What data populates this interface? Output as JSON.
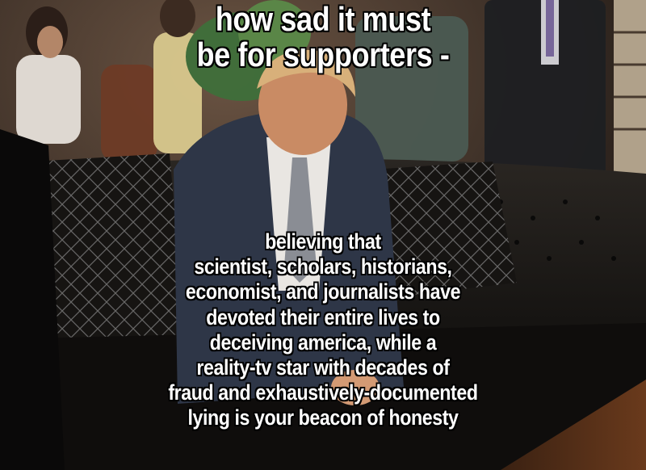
{
  "meme": {
    "top_text": [
      "how sad it must",
      "be for supporters -"
    ],
    "bottom_text": [
      "believing that",
      "scientist, scholars, historians,",
      "economist, and journalists have",
      "devoted their entire lives to",
      "deceiving america, while a",
      "reality-tv star with decades of",
      "fraud and exhaustively-documented",
      "lying is your beacon of honesty"
    ]
  },
  "colors": {
    "caption_fill": "#ffffff",
    "caption_stroke": "#000000",
    "sofa": "#141210",
    "suit": "#2e3647",
    "background": "#3a2e27"
  }
}
